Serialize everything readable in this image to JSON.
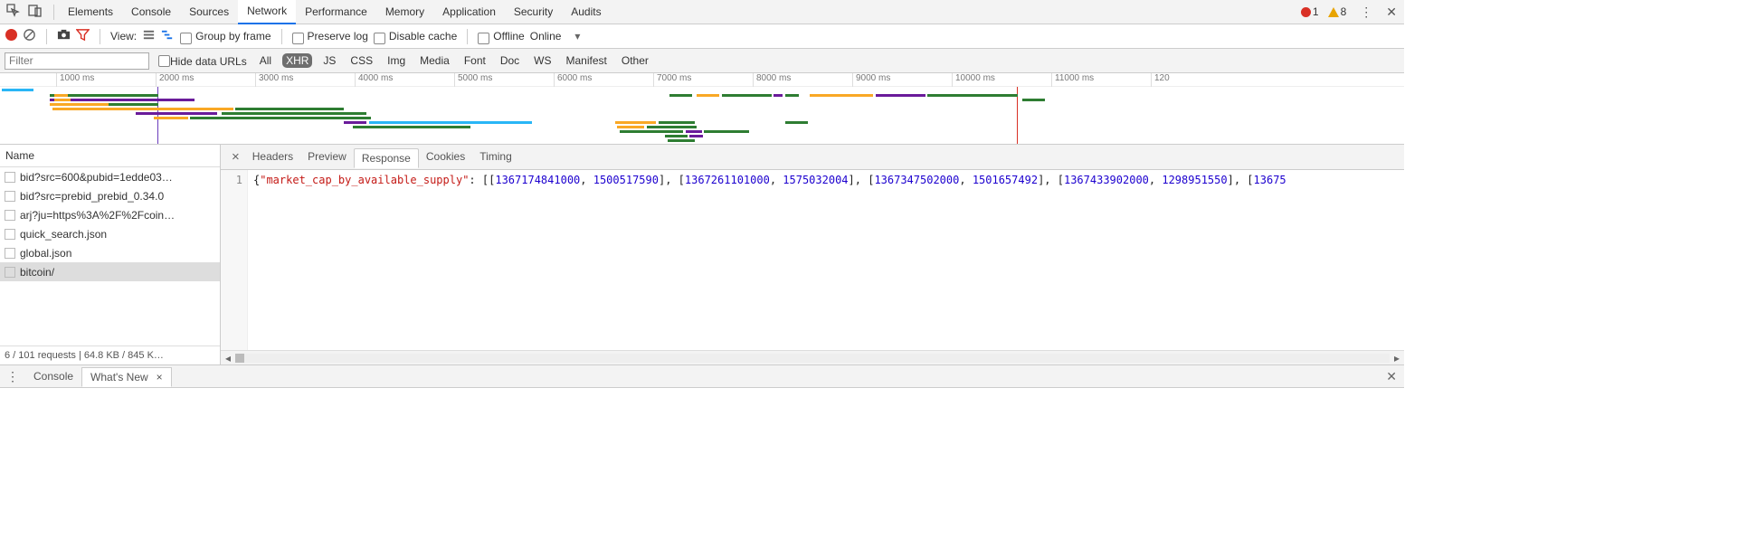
{
  "topTabs": [
    "Elements",
    "Console",
    "Sources",
    "Network",
    "Performance",
    "Memory",
    "Application",
    "Security",
    "Audits"
  ],
  "topTabsActive": "Network",
  "errors": {
    "errCount": "1",
    "warnCount": "8"
  },
  "toolbar": {
    "view": "View:",
    "groupByFrame": "Group by frame",
    "preserveLog": "Preserve log",
    "disableCache": "Disable cache",
    "offline": "Offline",
    "online": "Online"
  },
  "filterbar": {
    "filterPlaceholder": "Filter",
    "hideDataUrls": "Hide data URLs",
    "types": [
      "All",
      "XHR",
      "JS",
      "CSS",
      "Img",
      "Media",
      "Font",
      "Doc",
      "WS",
      "Manifest",
      "Other"
    ],
    "activeType": "XHR"
  },
  "timeline": {
    "ticks": [
      "1000 ms",
      "2000 ms",
      "3000 ms",
      "4000 ms",
      "5000 ms",
      "6000 ms",
      "7000 ms",
      "8000 ms",
      "9000 ms",
      "10000 ms",
      "11000 ms",
      "120"
    ],
    "tickPositions": [
      62,
      172,
      282,
      392,
      502,
      612,
      722,
      832,
      942,
      1052,
      1162,
      1272
    ]
  },
  "requestList": {
    "header": "Name",
    "items": [
      "bid?src=600&pubid=1edde03…",
      "bid?src=prebid_prebid_0.34.0",
      "arj?ju=https%3A%2F%2Fcoin…",
      "quick_search.json",
      "global.json",
      "bitcoin/"
    ],
    "selected": "bitcoin/",
    "status": "6 / 101 requests  |  64.8 KB / 845 K…"
  },
  "detailTabs": [
    "Headers",
    "Preview",
    "Response",
    "Cookies",
    "Timing"
  ],
  "detailTabActive": "Response",
  "response": {
    "lineNo": "1",
    "key": "\"market_cap_by_available_supply\"",
    "pairs": [
      [
        "1367174841000",
        "1500517590"
      ],
      [
        "1367261101000",
        "1575032004"
      ],
      [
        "1367347502000",
        "1501657492"
      ],
      [
        "1367433902000",
        "1298951550"
      ]
    ],
    "trailing": "13675"
  },
  "drawer": {
    "tabs": [
      "Console",
      "What's New"
    ],
    "active": "What's New"
  }
}
